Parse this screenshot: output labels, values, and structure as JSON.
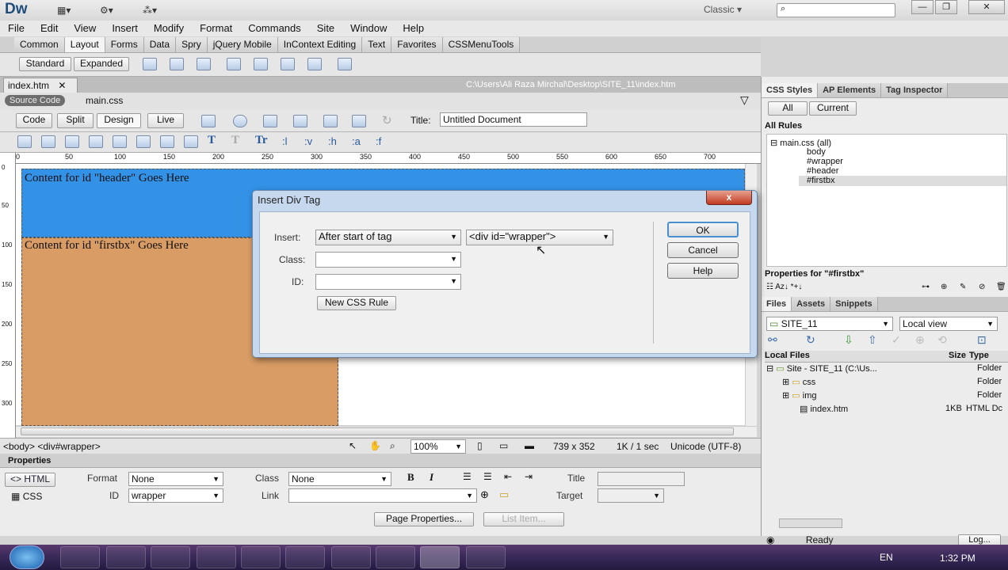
{
  "app": {
    "logo": "Dw",
    "workspace": "Classic",
    "workspace_arrow": "▾"
  },
  "window_buttons": {
    "min": "—",
    "max": "❐",
    "close": "✕"
  },
  "menu": [
    "File",
    "Edit",
    "View",
    "Insert",
    "Modify",
    "Format",
    "Commands",
    "Site",
    "Window",
    "Help"
  ],
  "insert_tabs": [
    "Common",
    "Layout",
    "Forms",
    "Data",
    "Spry",
    "jQuery Mobile",
    "InContext Editing",
    "Text",
    "Favorites",
    "CSSMenuTools"
  ],
  "insert_active": "Layout",
  "layout_bar": {
    "standard": "Standard",
    "expanded": "Expanded"
  },
  "doc_tab": {
    "name": "index.htm",
    "close": "✕",
    "path": "C:\\Users\\Ali Raza Mirchal\\Desktop\\SITE_11\\index.htm"
  },
  "related": {
    "source": "Source Code",
    "file": "main.css"
  },
  "doc_toolbar": {
    "code": "Code",
    "split": "Split",
    "design": "Design",
    "live": "Live",
    "title_label": "Title:",
    "title_value": "Untitled Document"
  },
  "format_bar": [
    ":l",
    ":v",
    ":h",
    ":a",
    ":f"
  ],
  "ruler_top": [
    "0",
    "50",
    "100",
    "150",
    "200",
    "250",
    "300",
    "350",
    "400",
    "450",
    "500",
    "550",
    "600",
    "650",
    "700"
  ],
  "ruler_left": [
    "0",
    "50",
    "100",
    "150",
    "200",
    "250",
    "300"
  ],
  "content": {
    "header_text": "Content for id \"header\" Goes Here",
    "firstbx_text": "Content for id \"firstbx\" Goes Here",
    "header_color": "#3391e6",
    "firstbx_color": "#d89c64"
  },
  "status": {
    "tags": "<body> <div#wrapper>",
    "zoom": "100%",
    "size": "739 x 352",
    "speed": "1K / 1 sec",
    "encoding": "Unicode (UTF-8)"
  },
  "properties": {
    "title": "Properties",
    "html_btn": "HTML",
    "css_btn": "CSS",
    "format_label": "Format",
    "format_value": "None",
    "id_label": "ID",
    "id_value": "wrapper",
    "class_label": "Class",
    "class_value": "None",
    "link_label": "Link",
    "title_label": "Title",
    "target_label": "Target",
    "page_props": "Page Properties...",
    "list_item": "List Item..."
  },
  "css_panel": {
    "tabs": [
      "CSS Styles",
      "AP Elements",
      "Tag Inspector"
    ],
    "all_btn": "All",
    "current_btn": "Current",
    "all_rules": "All Rules",
    "tree_root": "main.css (all)",
    "rules": [
      "body",
      "#wrapper",
      "#header",
      "#firstbx"
    ],
    "props_for": "Properties for \"#firstbx\""
  },
  "files_panel": {
    "tabs": [
      "Files",
      "Assets",
      "Snippets"
    ],
    "site": "SITE_11",
    "view": "Local view",
    "col_local": "Local Files",
    "col_size": "Size",
    "col_type": "Type",
    "rows": [
      {
        "name": "Site - SITE_11 (C:\\Us...",
        "size": "",
        "type": "Folder"
      },
      {
        "name": "css",
        "size": "",
        "type": "Folder"
      },
      {
        "name": "img",
        "size": "",
        "type": "Folder"
      },
      {
        "name": "index.htm",
        "size": "1KB",
        "type": "HTML Dc"
      }
    ],
    "status": "Ready",
    "log": "Log..."
  },
  "dialog": {
    "title": "Insert Div Tag",
    "insert_label": "Insert:",
    "insert_value": "After start of tag",
    "tag_value": "<div id=\"wrapper\">",
    "class_label": "Class:",
    "id_label": "ID:",
    "new_css": "New CSS Rule",
    "ok": "OK",
    "cancel": "Cancel",
    "help": "Help",
    "close": "x"
  },
  "taskbar": {
    "lang": "EN",
    "time": "1:32 PM"
  }
}
